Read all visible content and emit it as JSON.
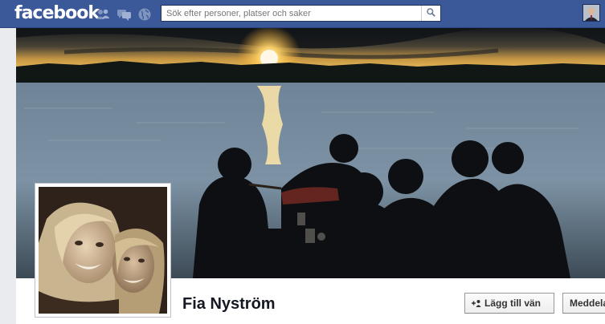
{
  "topbar": {
    "logo": "facebook",
    "search": {
      "placeholder": "Sök efter personer, platser och saker",
      "value": ""
    },
    "icons": [
      "friend-requests-icon",
      "messages-icon",
      "notifications-icon",
      "search-icon"
    ]
  },
  "profile": {
    "name": "Fia Nyström",
    "buttons": {
      "add_friend": "Lägg till vän",
      "message": "Meddelande"
    }
  },
  "colors": {
    "brand": "#3b5998",
    "page_bg": "#e9ebee"
  }
}
